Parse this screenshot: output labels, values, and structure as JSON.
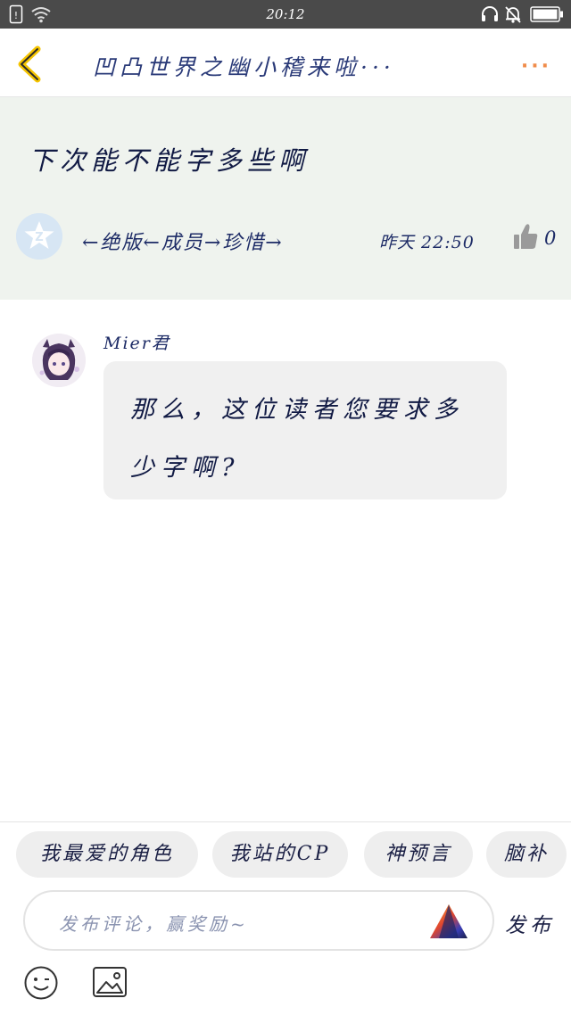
{
  "status_bar": {
    "time": "20:12",
    "icons": [
      "sim-icon",
      "wifi-icon",
      "headset-icon",
      "alarm-icon",
      "battery-icon"
    ]
  },
  "header": {
    "back_icon": "chevron-left-icon",
    "title": "凹凸世界之幽小稽来啦···",
    "more_label": "···"
  },
  "post": {
    "text": "下次能不能字多些啊",
    "author": "←绝版←成员→珍惜→",
    "time": "昨天 22:50",
    "like_count": "0"
  },
  "reply": {
    "name": "Mier君",
    "text": "那么，这位读者您要求多少字啊?"
  },
  "tags": [
    "我最爱的角色",
    "我站的CP",
    "神预言",
    "脑补"
  ],
  "comment": {
    "placeholder": "发布评论，赢奖励~",
    "publish_label": "发布"
  },
  "colors": {
    "accent_yellow": "#f5c400",
    "post_background": "#eff3ee",
    "bubble_background": "#f0f0f0",
    "more_orange": "#f08c4a"
  }
}
